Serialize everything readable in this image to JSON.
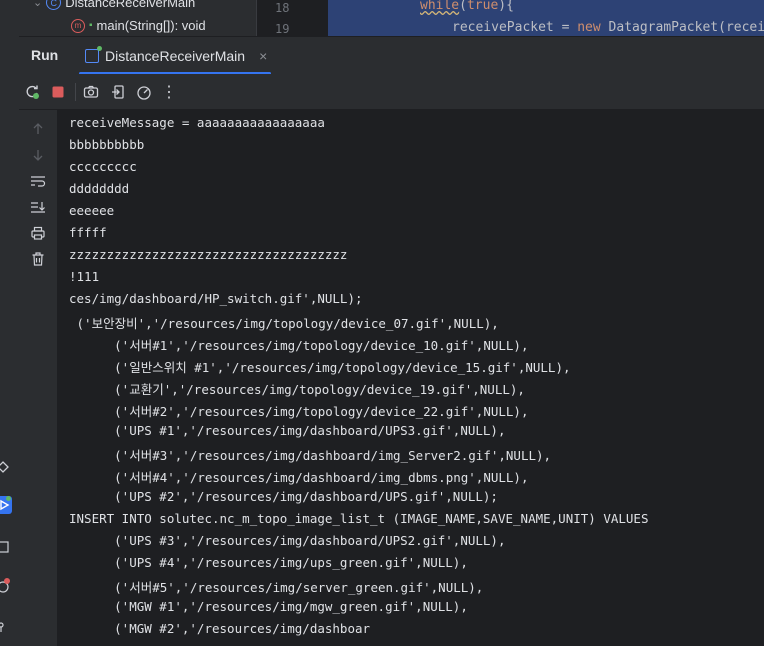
{
  "structure": {
    "class_name": "DistanceReceiverMain",
    "method_name": "main(String[]): void"
  },
  "editor": {
    "line_numbers": [
      "18",
      "19"
    ],
    "code_line_1_keyword": "while",
    "code_line_1_paren": "(",
    "code_line_1_value": "true",
    "code_line_1_end": "){",
    "code_line_2_var": "receivePacket",
    "code_line_2_eq": " = ",
    "code_line_2_new": "new",
    "code_line_2_rest": " DatagramPacket(recei"
  },
  "run_panel": {
    "title": "Run",
    "tab_label": "DistanceReceiverMain",
    "close_glyph": "×"
  },
  "toolbar": {
    "icons": [
      "rerun-icon",
      "stop-icon",
      "camera-icon",
      "login-icon",
      "gauge-icon",
      "more-icon"
    ],
    "more_glyph": "⋮"
  },
  "console": {
    "lines": [
      "receiveMessage = aaaaaaaaaaaaaaaaa",
      "bbbbbbbbbb",
      "ccccccccc",
      "dddddddd",
      "eeeeee",
      "fffff",
      "zzzzzzzzzzzzzzzzzzzzzzzzzzzzzzzzzzzzz",
      "!111",
      "ces/img/dashboard/HP_switch.gif',NULL);",
      " ('보안장비','/resources/img/topology/device_07.gif',NULL),",
      "      ('서버#1','/resources/img/topology/device_10.gif',NULL),",
      "      ('일반스위치 #1','/resources/img/topology/device_15.gif',NULL),",
      "      ('교환기','/resources/img/topology/device_19.gif',NULL),",
      "      ('서버#2','/resources/img/topology/device_22.gif',NULL),",
      "      ('UPS #1','/resources/img/dashboard/UPS3.gif',NULL),",
      "      ('서버#3','/resources/img/dashboard/img_Server2.gif',NULL),",
      "      ('서버#4','/resources/img/dashboard/img_dbms.png',NULL),",
      "      ('UPS #2','/resources/img/dashboard/UPS.gif',NULL);",
      "INSERT INTO solutec.nc_m_topo_image_list_t (IMAGE_NAME,SAVE_NAME,UNIT) VALUES",
      "      ('UPS #3','/resources/img/dashboard/UPS2.gif',NULL),",
      "      ('UPS #4','/resources/img/ups_green.gif',NULL),",
      "      ('서버#5','/resources/img/server_green.gif',NULL),",
      "      ('MGW #1','/resources/img/mgw_green.gif',NULL),",
      "      ('MGW #2','/resources/img/dashboar"
    ]
  },
  "colors": {
    "accent": "#3574f0",
    "keyword": "#cf8e6d",
    "stop_red": "#db5c5c",
    "rerun_green": "#5fb865"
  }
}
